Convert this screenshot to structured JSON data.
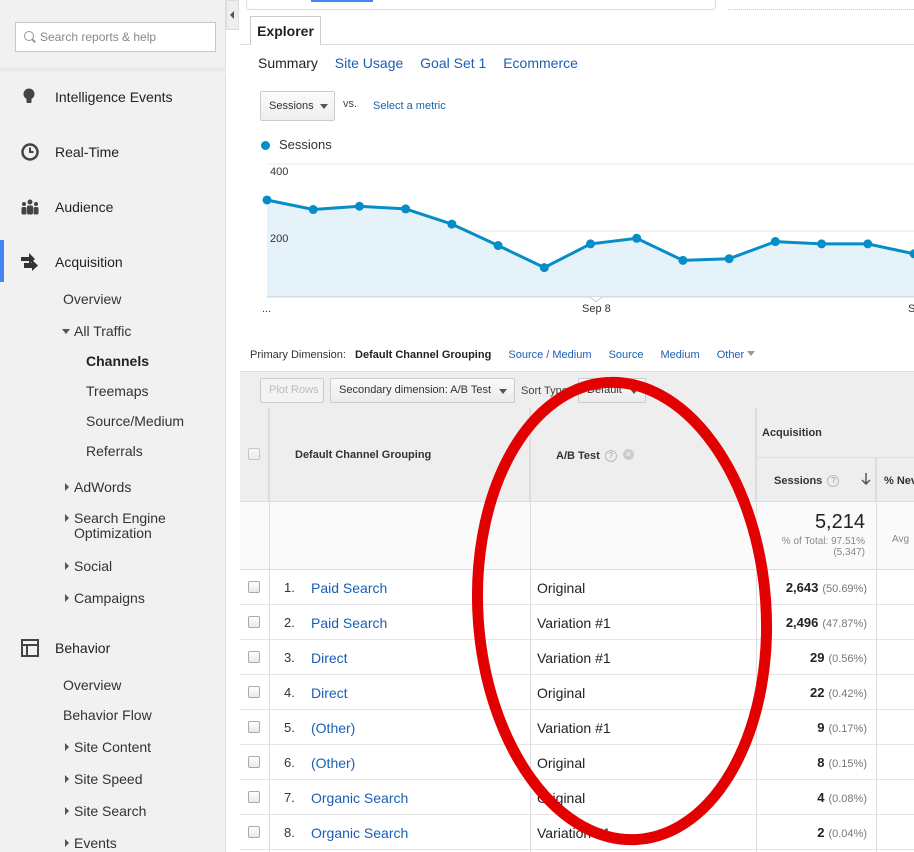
{
  "sidebar": {
    "search_placeholder": "Search reports & help",
    "sections": [
      {
        "label": "Intelligence Events",
        "icon": "lightbulb-icon"
      },
      {
        "label": "Real-Time",
        "icon": "clock-icon"
      },
      {
        "label": "Audience",
        "icon": "people-icon"
      },
      {
        "label": "Acquisition",
        "icon": "acquisition-arrows-icon"
      },
      {
        "label": "Behavior",
        "icon": "behavior-layout-icon"
      }
    ],
    "acquisition_items": {
      "overview": "Overview",
      "all_traffic": "All Traffic",
      "channels": "Channels",
      "treemaps": "Treemaps",
      "source_medium": "Source/Medium",
      "referrals": "Referrals",
      "adwords": "AdWords",
      "seo_line1": "Search Engine",
      "seo_line2": "Optimization",
      "social": "Social",
      "campaigns": "Campaigns"
    },
    "behavior_items": {
      "overview": "Overview",
      "behavior_flow": "Behavior Flow",
      "site_content": "Site Content",
      "site_speed": "Site Speed",
      "site_search": "Site Search",
      "events": "Events"
    }
  },
  "explorer": {
    "tab": "Explorer",
    "subtabs": [
      "Summary",
      "Site Usage",
      "Goal Set 1",
      "Ecommerce"
    ]
  },
  "metric": {
    "selected": "Sessions",
    "vs": "vs.",
    "select_link": "Select a metric",
    "legend": "Sessions"
  },
  "chart_data": {
    "type": "area",
    "series": [
      {
        "name": "Sessions",
        "values": [
          294,
          265,
          275,
          267,
          221,
          156,
          89,
          161,
          178,
          111,
          116,
          168,
          161,
          161,
          131
        ]
      }
    ],
    "y_ticks": [
      "400",
      "200"
    ],
    "x_ticks": [
      "...",
      "Sep 8",
      "S"
    ],
    "color": "#058dc7"
  },
  "primary_dimension": {
    "label": "Primary Dimension:",
    "current": "Default Channel Grouping",
    "options": [
      "Source / Medium",
      "Source",
      "Medium",
      "Other"
    ]
  },
  "toolbar": {
    "plot_rows": "Plot Rows",
    "secondary_dimension": "Secondary dimension: A/B Test",
    "sort_type_label": "Sort Type:",
    "sort_type_value": "Default"
  },
  "table": {
    "col_dimension": "Default Channel Grouping",
    "col_secondary": "A/B Test",
    "group_header": "Acquisition",
    "col_sessions": "Sessions",
    "col_new": "% Nev",
    "totals": {
      "sessions": "5,214",
      "sessions_pct": "% of Total: 97.51%",
      "sessions_total": "(5,347)",
      "new_fragment": "Avg"
    },
    "rows": [
      {
        "num": "1.",
        "channel": "Paid Search",
        "ab": "Original",
        "sessions": "2,643",
        "pct": "(50.69%)"
      },
      {
        "num": "2.",
        "channel": "Paid Search",
        "ab": "Variation #1",
        "sessions": "2,496",
        "pct": "(47.87%)"
      },
      {
        "num": "3.",
        "channel": "Direct",
        "ab": "Variation #1",
        "sessions": "29",
        "pct": "(0.56%)"
      },
      {
        "num": "4.",
        "channel": "Direct",
        "ab": "Original",
        "sessions": "22",
        "pct": "(0.42%)"
      },
      {
        "num": "5.",
        "channel": "(Other)",
        "ab": "Variation #1",
        "sessions": "9",
        "pct": "(0.17%)"
      },
      {
        "num": "6.",
        "channel": "(Other)",
        "ab": "Original",
        "sessions": "8",
        "pct": "(0.15%)"
      },
      {
        "num": "7.",
        "channel": "Organic Search",
        "ab": "Original",
        "sessions": "4",
        "pct": "(0.08%)"
      },
      {
        "num": "8.",
        "channel": "Organic Search",
        "ab": "Variation #1",
        "sessions": "2",
        "pct": "(0.04%)"
      }
    ]
  },
  "annotation": {
    "color": "#e30000"
  }
}
